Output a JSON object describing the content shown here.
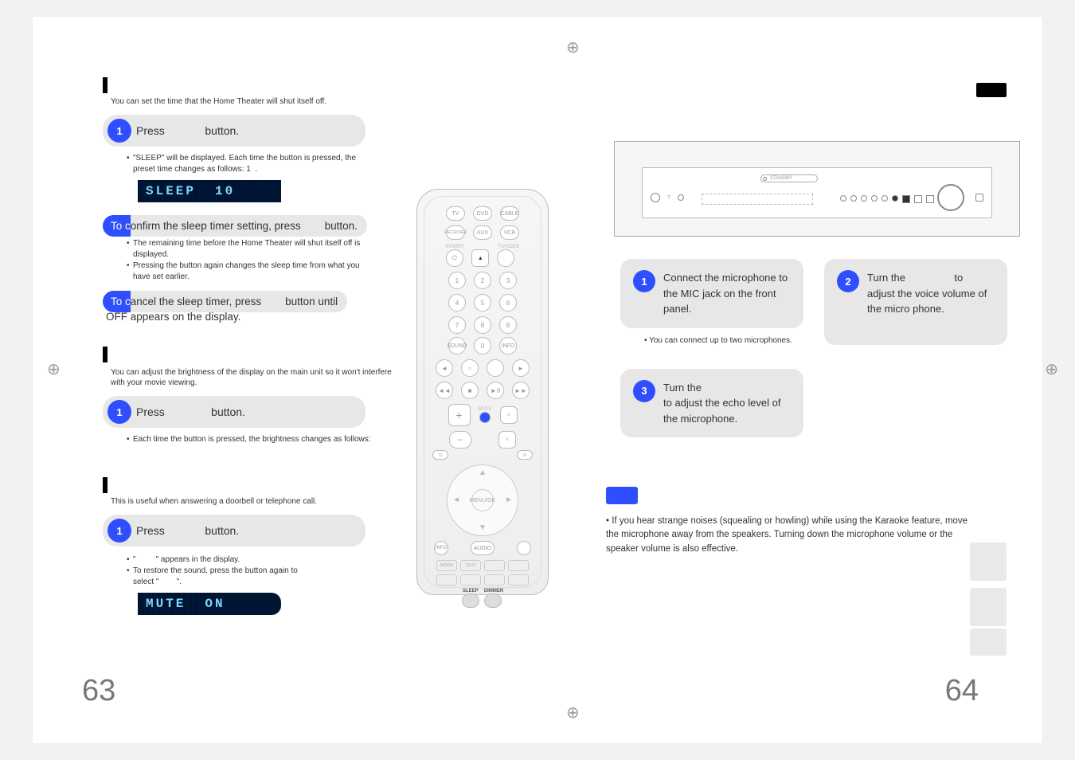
{
  "left_page": {
    "intro_sleep": "You can set the time that the Home Theater will shut itself off.",
    "step1": {
      "press": "Press",
      "button": "button."
    },
    "sleep_sub": "\"SLEEP\" will be displayed. Each time the button is pressed, the preset time changes as follows: 1",
    "sleep_display": {
      "label": "SLEEP",
      "value": "10"
    },
    "confirm_line": {
      "prefix": "To confirm the sleep timer setting, press",
      "suffix": "button."
    },
    "confirm_bullets": [
      "The remaining time before the Home Theater will shut itself off is displayed.",
      "Pressing the button again changes the sleep time from what you have set earlier."
    ],
    "cancel_line": {
      "prefix": "To cancel the sleep timer, press",
      "mid": "button until",
      "suffix": "OFF appears on the display."
    },
    "intro_dimmer": "You can adjust the brightness of the display on the main unit so it won't interfere with your movie viewing.",
    "step_dimmer": {
      "press": "Press",
      "button": "button."
    },
    "dimmer_sub": "Each time the button is pressed, the brightness changes as follows:",
    "intro_mute": "This is useful when answering a doorbell or telephone call.",
    "step_mute": {
      "press": "Press",
      "button": "button."
    },
    "mute_bullet1_suffix": "appears in the display.",
    "mute_bullet2_line1": "To restore the sound, press the button again to",
    "mute_bullet2_line2": "select \"",
    "mute_display": {
      "label": "MUTE",
      "value": "ON"
    },
    "page_num": "63"
  },
  "remote": {
    "top_row": [
      "TV",
      "DVD",
      "CABLE"
    ],
    "row2": [
      "RECEIVER",
      "AUX",
      "VCR"
    ],
    "power_label": "POWER",
    "tv_vid_label": "TV/VIDEO",
    "keypad": [
      "1",
      "2",
      "3",
      "4",
      "5",
      "6",
      "7",
      "8",
      "9"
    ],
    "nav_btns": [
      "◄◄",
      "■",
      "►II",
      "►►"
    ],
    "mute": "MUTE",
    "center": "MENU/OK",
    "bottom_small": [
      "INFO",
      "AUDIO"
    ],
    "mode_row": [
      "MODE",
      "TEST",
      "SLEEP",
      "DIMMER"
    ],
    "special": [
      "SLEEP",
      "DIMMER"
    ]
  },
  "right_page": {
    "card1": "Connect the microphone to the MIC jack on the front panel.",
    "card1_note": "You can connect up to two microphones.",
    "card2_pre": "Turn the",
    "card2_mid": "to adjust the voice volume of the micro phone.",
    "card3_pre": "Turn the",
    "card3_rest": "to adjust the echo level of the microphone.",
    "note": "If you hear strange noises (squealing or howling) while using the Karaoke feature, move the microphone away from the speakers. Turning down the microphone volume or the speaker volume is also effective.",
    "page_num": "64"
  }
}
